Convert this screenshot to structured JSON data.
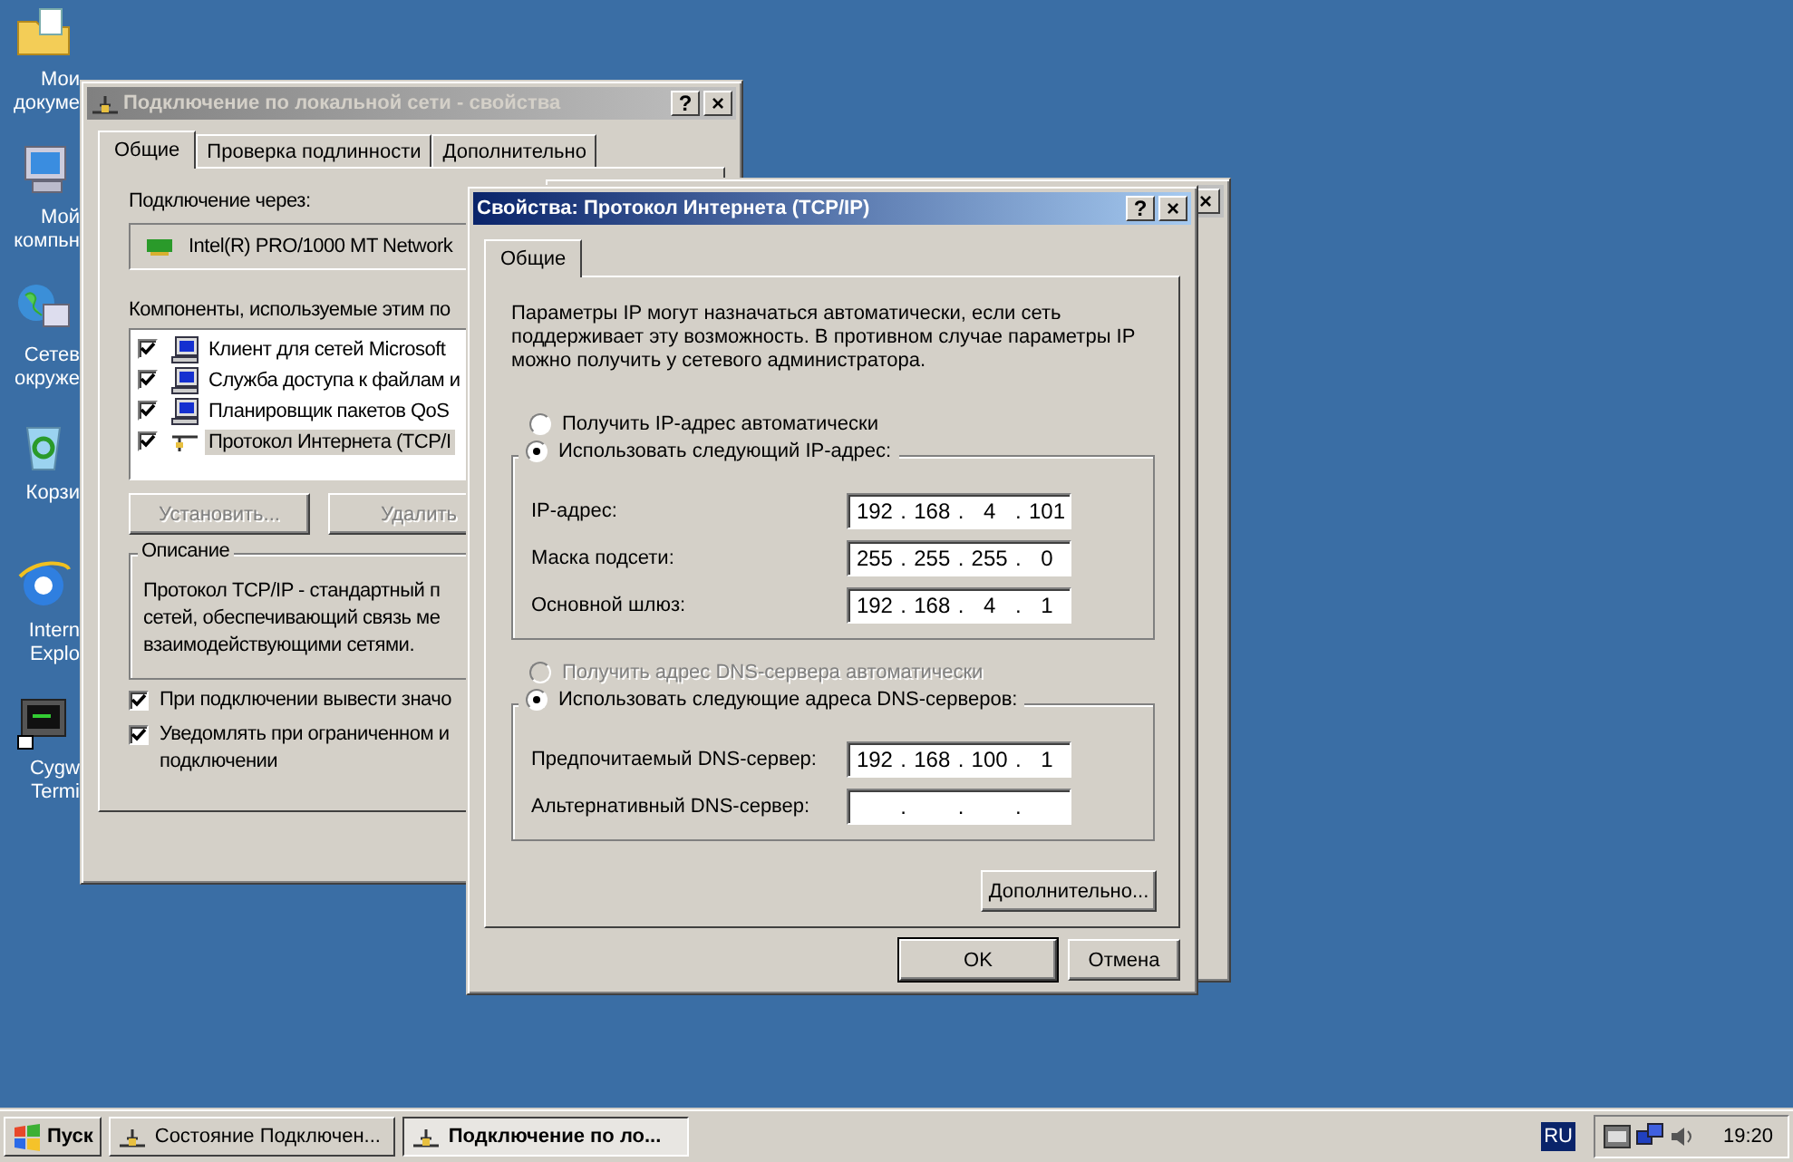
{
  "desktop_icons": [
    {
      "kind": "documents",
      "lines": [
        "Мои",
        "докуме"
      ]
    },
    {
      "kind": "computer",
      "lines": [
        "Мой",
        "компьн"
      ]
    },
    {
      "kind": "network",
      "lines": [
        "Сетев",
        "окруже"
      ]
    },
    {
      "kind": "recycle",
      "lines": [
        "Корзи"
      ]
    },
    {
      "kind": "browser",
      "lines": [
        "Intern",
        "Explo"
      ]
    },
    {
      "kind": "terminal",
      "lines": [
        "Cygw",
        "Termi"
      ]
    }
  ],
  "back_window": {
    "title": "Подключение по локальной сети - свойства",
    "help": "?",
    "close": "×",
    "tabs": [
      {
        "label": "Общие",
        "selected": true
      },
      {
        "label": "Проверка подлинности",
        "selected": false
      },
      {
        "label": "Дополнительно",
        "selected": false
      }
    ],
    "connect_label": "Подключение через:",
    "adapter": "Intel(R) PRO/1000 MT Network",
    "components_label": "Компоненты, используемые этим по",
    "components": [
      {
        "kind": "computer",
        "label": "Клиент для сетей Microsoft",
        "checked": true,
        "selected": false
      },
      {
        "kind": "computer",
        "label": "Служба доступа к файлам и",
        "checked": true,
        "selected": false
      },
      {
        "kind": "computer",
        "label": "Планировщик пакетов QoS",
        "checked": true,
        "selected": false
      },
      {
        "kind": "protocol",
        "label": "Протокол Интернета (TCP/I",
        "checked": true,
        "selected": true
      }
    ],
    "buttons": [
      {
        "label": "Установить...",
        "disabled": true
      },
      {
        "label": "Удалить",
        "disabled": true
      }
    ],
    "description_title": "Описание",
    "description_lines": [
      "Протокол TCP/IP - стандартный п",
      "сетей, обеспечивающий связь ме",
      "взаимодействующими сетями."
    ],
    "options": [
      {
        "lines": [
          "При подключении вывести значо"
        ],
        "checked": true
      },
      {
        "lines": [
          "Уведомлять при ограниченном и",
          "подключении"
        ],
        "checked": true
      }
    ]
  },
  "middle_window": {
    "close": "×"
  },
  "front_window": {
    "title": "Свойства: Протокол Интернета (TCP/IP)",
    "help": "?",
    "close": "×",
    "tabs": [
      {
        "label": "Общие",
        "selected": true
      }
    ],
    "intro": "Параметры IP могут назначаться автоматически, если сеть поддерживает эту возможность. В противном случае параметры IP можно получить у сетевого администратора.",
    "ip_auto": {
      "label": "Получить IP-адрес автоматически",
      "selected": false,
      "disabled": false
    },
    "ip_manual": {
      "label": "Использовать следующий IP-адрес:",
      "selected": true,
      "disabled": false
    },
    "ip_fields": [
      {
        "label": "IP-адрес:",
        "parts": [
          {
            "kind": "octet",
            "text": "192"
          },
          {
            "kind": "dot",
            "text": "."
          },
          {
            "kind": "octet",
            "text": "168"
          },
          {
            "kind": "dot",
            "text": "."
          },
          {
            "kind": "octet",
            "text": "4"
          },
          {
            "kind": "dot",
            "text": "."
          },
          {
            "kind": "octet",
            "text": "101"
          }
        ]
      },
      {
        "label": "Маска подсети:",
        "parts": [
          {
            "kind": "octet",
            "text": "255"
          },
          {
            "kind": "dot",
            "text": "."
          },
          {
            "kind": "octet",
            "text": "255"
          },
          {
            "kind": "dot",
            "text": "."
          },
          {
            "kind": "octet",
            "text": "255"
          },
          {
            "kind": "dot",
            "text": "."
          },
          {
            "kind": "octet",
            "text": "0"
          }
        ]
      },
      {
        "label": "Основной шлюз:",
        "parts": [
          {
            "kind": "octet",
            "text": "192"
          },
          {
            "kind": "dot",
            "text": "."
          },
          {
            "kind": "octet",
            "text": "168"
          },
          {
            "kind": "dot",
            "text": "."
          },
          {
            "kind": "octet",
            "text": "4"
          },
          {
            "kind": "dot",
            "text": "."
          },
          {
            "kind": "octet",
            "text": "1"
          }
        ]
      }
    ],
    "dns_auto": {
      "label": "Получить адрес DNS-сервера автоматически",
      "selected": false,
      "disabled": true
    },
    "dns_manual": {
      "label": "Использовать следующие адреса DNS-серверов:",
      "selected": true,
      "disabled": false
    },
    "dns_fields": [
      {
        "label": "Предпочитаемый DNS-сервер:",
        "parts": [
          {
            "kind": "octet",
            "text": "192"
          },
          {
            "kind": "dot",
            "text": "."
          },
          {
            "kind": "octet",
            "text": "168"
          },
          {
            "kind": "dot",
            "text": "."
          },
          {
            "kind": "octet",
            "text": "100"
          },
          {
            "kind": "dot",
            "text": "."
          },
          {
            "kind": "octet",
            "text": "1"
          }
        ]
      },
      {
        "label": "Альтернативный DNS-сервер:",
        "parts": [
          {
            "kind": "gap"
          },
          {
            "kind": "dot",
            "text": "."
          },
          {
            "kind": "gap"
          },
          {
            "kind": "dot",
            "text": "."
          },
          {
            "kind": "gap"
          },
          {
            "kind": "dot",
            "text": "."
          },
          {
            "kind": "gap"
          }
        ]
      }
    ],
    "advanced_button": "Дополнительно...",
    "ok_button": "OK",
    "cancel_button": "Отмена"
  },
  "taskbar": {
    "start": "Пуск",
    "tasks": [
      {
        "label": "Состояние Подключен...",
        "selected": false
      },
      {
        "label": "Подключение по ло...",
        "selected": true
      }
    ],
    "language": "RU",
    "clock": "19:20"
  }
}
